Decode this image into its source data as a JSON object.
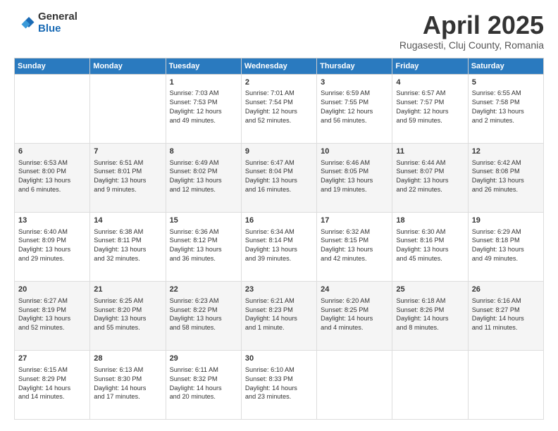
{
  "logo": {
    "general": "General",
    "blue": "Blue"
  },
  "title": {
    "month_year": "April 2025",
    "location": "Rugasesti, Cluj County, Romania"
  },
  "days_of_week": [
    "Sunday",
    "Monday",
    "Tuesday",
    "Wednesday",
    "Thursday",
    "Friday",
    "Saturday"
  ],
  "weeks": [
    [
      {
        "day": "",
        "info": ""
      },
      {
        "day": "",
        "info": ""
      },
      {
        "day": "1",
        "info": "Sunrise: 7:03 AM\nSunset: 7:53 PM\nDaylight: 12 hours\nand 49 minutes."
      },
      {
        "day": "2",
        "info": "Sunrise: 7:01 AM\nSunset: 7:54 PM\nDaylight: 12 hours\nand 52 minutes."
      },
      {
        "day": "3",
        "info": "Sunrise: 6:59 AM\nSunset: 7:55 PM\nDaylight: 12 hours\nand 56 minutes."
      },
      {
        "day": "4",
        "info": "Sunrise: 6:57 AM\nSunset: 7:57 PM\nDaylight: 12 hours\nand 59 minutes."
      },
      {
        "day": "5",
        "info": "Sunrise: 6:55 AM\nSunset: 7:58 PM\nDaylight: 13 hours\nand 2 minutes."
      }
    ],
    [
      {
        "day": "6",
        "info": "Sunrise: 6:53 AM\nSunset: 8:00 PM\nDaylight: 13 hours\nand 6 minutes."
      },
      {
        "day": "7",
        "info": "Sunrise: 6:51 AM\nSunset: 8:01 PM\nDaylight: 13 hours\nand 9 minutes."
      },
      {
        "day": "8",
        "info": "Sunrise: 6:49 AM\nSunset: 8:02 PM\nDaylight: 13 hours\nand 12 minutes."
      },
      {
        "day": "9",
        "info": "Sunrise: 6:47 AM\nSunset: 8:04 PM\nDaylight: 13 hours\nand 16 minutes."
      },
      {
        "day": "10",
        "info": "Sunrise: 6:46 AM\nSunset: 8:05 PM\nDaylight: 13 hours\nand 19 minutes."
      },
      {
        "day": "11",
        "info": "Sunrise: 6:44 AM\nSunset: 8:07 PM\nDaylight: 13 hours\nand 22 minutes."
      },
      {
        "day": "12",
        "info": "Sunrise: 6:42 AM\nSunset: 8:08 PM\nDaylight: 13 hours\nand 26 minutes."
      }
    ],
    [
      {
        "day": "13",
        "info": "Sunrise: 6:40 AM\nSunset: 8:09 PM\nDaylight: 13 hours\nand 29 minutes."
      },
      {
        "day": "14",
        "info": "Sunrise: 6:38 AM\nSunset: 8:11 PM\nDaylight: 13 hours\nand 32 minutes."
      },
      {
        "day": "15",
        "info": "Sunrise: 6:36 AM\nSunset: 8:12 PM\nDaylight: 13 hours\nand 36 minutes."
      },
      {
        "day": "16",
        "info": "Sunrise: 6:34 AM\nSunset: 8:14 PM\nDaylight: 13 hours\nand 39 minutes."
      },
      {
        "day": "17",
        "info": "Sunrise: 6:32 AM\nSunset: 8:15 PM\nDaylight: 13 hours\nand 42 minutes."
      },
      {
        "day": "18",
        "info": "Sunrise: 6:30 AM\nSunset: 8:16 PM\nDaylight: 13 hours\nand 45 minutes."
      },
      {
        "day": "19",
        "info": "Sunrise: 6:29 AM\nSunset: 8:18 PM\nDaylight: 13 hours\nand 49 minutes."
      }
    ],
    [
      {
        "day": "20",
        "info": "Sunrise: 6:27 AM\nSunset: 8:19 PM\nDaylight: 13 hours\nand 52 minutes."
      },
      {
        "day": "21",
        "info": "Sunrise: 6:25 AM\nSunset: 8:20 PM\nDaylight: 13 hours\nand 55 minutes."
      },
      {
        "day": "22",
        "info": "Sunrise: 6:23 AM\nSunset: 8:22 PM\nDaylight: 13 hours\nand 58 minutes."
      },
      {
        "day": "23",
        "info": "Sunrise: 6:21 AM\nSunset: 8:23 PM\nDaylight: 14 hours\nand 1 minute."
      },
      {
        "day": "24",
        "info": "Sunrise: 6:20 AM\nSunset: 8:25 PM\nDaylight: 14 hours\nand 4 minutes."
      },
      {
        "day": "25",
        "info": "Sunrise: 6:18 AM\nSunset: 8:26 PM\nDaylight: 14 hours\nand 8 minutes."
      },
      {
        "day": "26",
        "info": "Sunrise: 6:16 AM\nSunset: 8:27 PM\nDaylight: 14 hours\nand 11 minutes."
      }
    ],
    [
      {
        "day": "27",
        "info": "Sunrise: 6:15 AM\nSunset: 8:29 PM\nDaylight: 14 hours\nand 14 minutes."
      },
      {
        "day": "28",
        "info": "Sunrise: 6:13 AM\nSunset: 8:30 PM\nDaylight: 14 hours\nand 17 minutes."
      },
      {
        "day": "29",
        "info": "Sunrise: 6:11 AM\nSunset: 8:32 PM\nDaylight: 14 hours\nand 20 minutes."
      },
      {
        "day": "30",
        "info": "Sunrise: 6:10 AM\nSunset: 8:33 PM\nDaylight: 14 hours\nand 23 minutes."
      },
      {
        "day": "",
        "info": ""
      },
      {
        "day": "",
        "info": ""
      },
      {
        "day": "",
        "info": ""
      }
    ]
  ]
}
